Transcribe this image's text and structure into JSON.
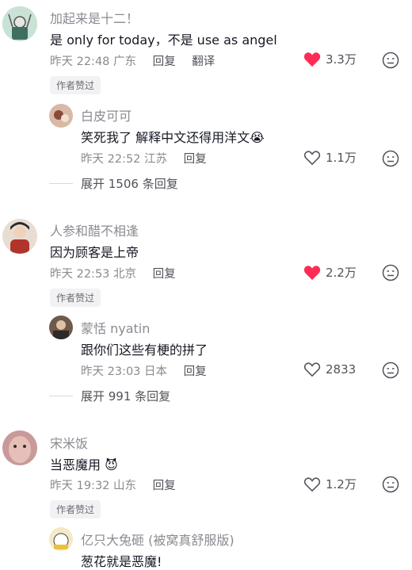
{
  "colors": {
    "like_red": "#fe2c55",
    "muted": "#8a8b91"
  },
  "comments": [
    {
      "name": "加起来是十二！",
      "text": "是 only for today，不是 use as angel",
      "time": "昨天 22:48",
      "location": "广东",
      "reply": "回复",
      "translate": "翻译",
      "likes": "3.3万",
      "liked": true,
      "badge": "作者赞过",
      "sub": {
        "name": "白皮可可",
        "text": "笑死我了 解释中文还得用洋文",
        "emoji": "😭",
        "time": "22:52",
        "location": "江苏",
        "reply": "回复",
        "likes": "1.1万"
      },
      "expand": "展开 1506 条回复"
    },
    {
      "name": "人参和醋不相逢",
      "text": "因为顾客是上帝",
      "time": "昨天 22:53",
      "location": "北京",
      "reply": "回复",
      "likes": "2.2万",
      "liked": true,
      "badge": "作者赞过",
      "sub": {
        "name": "蒙恬 nyatin",
        "text": "跟你们这些有梗的拼了",
        "time": "昨天 23:03",
        "location": "日本",
        "reply": "回复",
        "likes": "2833"
      },
      "expand": "展开 991 条回复"
    },
    {
      "name": "宋米饭",
      "text": "当恶魔用",
      "emoji": "😈",
      "time": "昨天 19:32",
      "location": "山东",
      "reply": "回复",
      "likes": "1.2万",
      "liked": false,
      "badge": "作者赞过",
      "sub": {
        "name": "亿只大兔砸 (被窝真舒服版)",
        "text": "葱花就是恶魔!"
      }
    }
  ],
  "icons": {
    "like": "heart-icon",
    "dislike": "dislike-face-icon"
  }
}
